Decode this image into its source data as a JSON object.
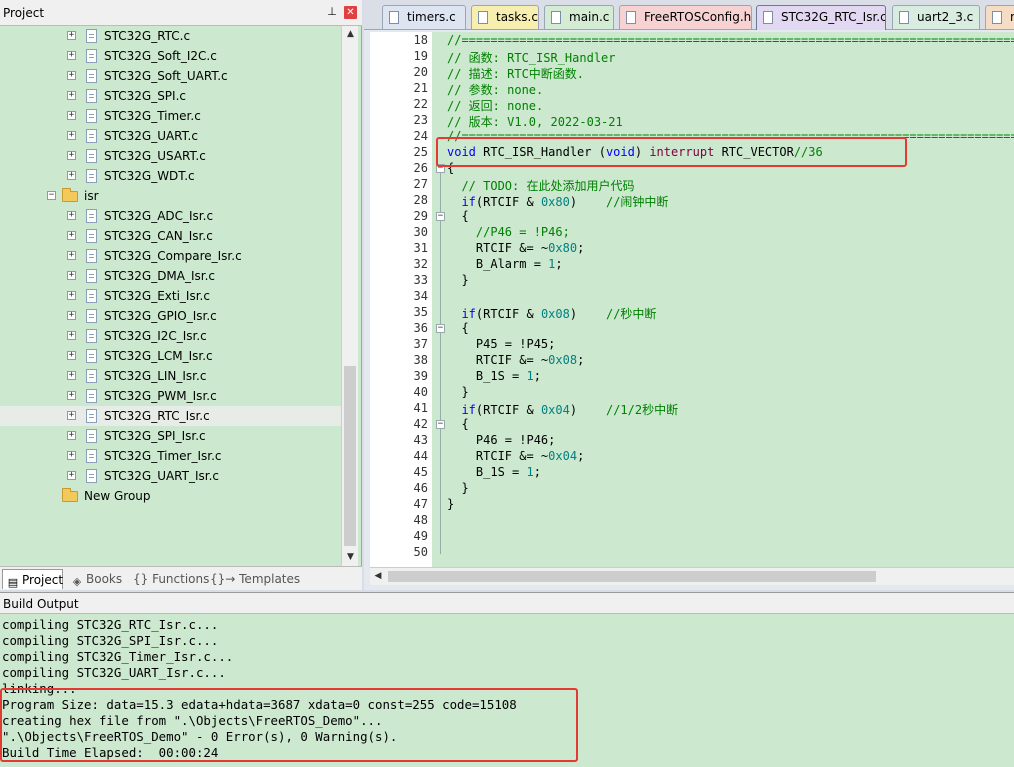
{
  "project_pane": {
    "title": "Project",
    "tree": [
      {
        "label": "STC32G_RTC.c",
        "type": "file",
        "level": 2
      },
      {
        "label": "STC32G_Soft_I2C.c",
        "type": "file",
        "level": 2
      },
      {
        "label": "STC32G_Soft_UART.c",
        "type": "file",
        "level": 2
      },
      {
        "label": "STC32G_SPI.c",
        "type": "file",
        "level": 2
      },
      {
        "label": "STC32G_Timer.c",
        "type": "file",
        "level": 2
      },
      {
        "label": "STC32G_UART.c",
        "type": "file",
        "level": 2
      },
      {
        "label": "STC32G_USART.c",
        "type": "file",
        "level": 2
      },
      {
        "label": "STC32G_WDT.c",
        "type": "file",
        "level": 2
      },
      {
        "label": "isr",
        "type": "folder",
        "level": 1,
        "expanded": true
      },
      {
        "label": "STC32G_ADC_Isr.c",
        "type": "file",
        "level": 2
      },
      {
        "label": "STC32G_CAN_Isr.c",
        "type": "file",
        "level": 2
      },
      {
        "label": "STC32G_Compare_Isr.c",
        "type": "file",
        "level": 2
      },
      {
        "label": "STC32G_DMA_Isr.c",
        "type": "file",
        "level": 2
      },
      {
        "label": "STC32G_Exti_Isr.c",
        "type": "file",
        "level": 2
      },
      {
        "label": "STC32G_GPIO_Isr.c",
        "type": "file",
        "level": 2
      },
      {
        "label": "STC32G_I2C_Isr.c",
        "type": "file",
        "level": 2
      },
      {
        "label": "STC32G_LCM_Isr.c",
        "type": "file",
        "level": 2
      },
      {
        "label": "STC32G_LIN_Isr.c",
        "type": "file",
        "level": 2
      },
      {
        "label": "STC32G_PWM_Isr.c",
        "type": "file",
        "level": 2
      },
      {
        "label": "STC32G_RTC_Isr.c",
        "type": "file",
        "level": 2,
        "selected": true
      },
      {
        "label": "STC32G_SPI_Isr.c",
        "type": "file",
        "level": 2
      },
      {
        "label": "STC32G_Timer_Isr.c",
        "type": "file",
        "level": 2
      },
      {
        "label": "STC32G_UART_Isr.c",
        "type": "file",
        "level": 2
      },
      {
        "label": "New Group",
        "type": "folder",
        "level": 0,
        "expanded": false
      }
    ],
    "bottom_tabs": [
      {
        "label": "Project",
        "icon": "project-icon",
        "active": true
      },
      {
        "label": "Books",
        "icon": "books-icon",
        "active": false
      },
      {
        "label": "{} Functions",
        "icon": "",
        "active": false
      },
      {
        "label": "{}→ Templates",
        "icon": "",
        "active": false
      }
    ]
  },
  "editor": {
    "tabs": [
      {
        "label": "timers.c",
        "color": "#dde5f3",
        "active": false
      },
      {
        "label": "tasks.c",
        "color": "#f7efb0",
        "active": false
      },
      {
        "label": "main.c",
        "color": "#d4ecd4",
        "active": false
      },
      {
        "label": "FreeRTOSConfig.h",
        "color": "#f7d2d2",
        "active": false
      },
      {
        "label": "STC32G_RTC_Isr.c*",
        "color": "#e2d8f2",
        "active": true
      },
      {
        "label": "uart2_3.c",
        "color": "#d8ece0",
        "active": false
      },
      {
        "label": "r",
        "color": "#f5dcc4",
        "active": false
      }
    ],
    "lines": [
      {
        "n": "18",
        "fold": "",
        "tokens": [
          {
            "t": "//==============================================================================",
            "c": "cmt"
          }
        ]
      },
      {
        "n": "19",
        "fold": "",
        "tokens": [
          {
            "t": "// 函数: RTC_ISR_Handler",
            "c": "cmt"
          }
        ]
      },
      {
        "n": "20",
        "fold": "",
        "tokens": [
          {
            "t": "// 描述: RTC中断函数.",
            "c": "cmt"
          }
        ]
      },
      {
        "n": "21",
        "fold": "",
        "tokens": [
          {
            "t": "// 参数: none.",
            "c": "cmt"
          }
        ]
      },
      {
        "n": "22",
        "fold": "",
        "tokens": [
          {
            "t": "// 返回: none.",
            "c": "cmt"
          }
        ]
      },
      {
        "n": "23",
        "fold": "",
        "tokens": [
          {
            "t": "// 版本: V1.0, 2022-03-21",
            "c": "cmt"
          }
        ]
      },
      {
        "n": "24",
        "fold": "",
        "tokens": [
          {
            "t": "//==============================================================================",
            "c": "cmt"
          }
        ]
      },
      {
        "n": "25",
        "fold": "",
        "tokens": [
          {
            "t": "void",
            "c": "kw"
          },
          {
            "t": " RTC_ISR_Handler (",
            "c": "txt"
          },
          {
            "t": "void",
            "c": "kw"
          },
          {
            "t": ") ",
            "c": "txt"
          },
          {
            "t": "interrupt",
            "c": "intr"
          },
          {
            "t": " RTC_VECTOR",
            "c": "txt"
          },
          {
            "t": "//36",
            "c": "cmt"
          }
        ]
      },
      {
        "n": "26",
        "fold": "minus",
        "tokens": [
          {
            "t": "{",
            "c": "txt"
          }
        ]
      },
      {
        "n": "27",
        "fold": "",
        "tokens": [
          {
            "t": "  ",
            "c": "txt"
          },
          {
            "t": "// TODO: 在此处添加用户代码",
            "c": "cmt"
          }
        ]
      },
      {
        "n": "28",
        "fold": "",
        "tokens": [
          {
            "t": "  ",
            "c": "txt"
          },
          {
            "t": "if",
            "c": "kw"
          },
          {
            "t": "(RTCIF & ",
            "c": "txt"
          },
          {
            "t": "0x80",
            "c": "num"
          },
          {
            "t": ")    ",
            "c": "txt"
          },
          {
            "t": "//闹钟中断",
            "c": "cmt"
          }
        ]
      },
      {
        "n": "29",
        "fold": "minus",
        "tokens": [
          {
            "t": "  {",
            "c": "txt"
          }
        ]
      },
      {
        "n": "30",
        "fold": "",
        "tokens": [
          {
            "t": "    ",
            "c": "txt"
          },
          {
            "t": "//P46 = !P46;",
            "c": "cmt"
          }
        ]
      },
      {
        "n": "31",
        "fold": "",
        "tokens": [
          {
            "t": "    RTCIF &= ~",
            "c": "txt"
          },
          {
            "t": "0x80",
            "c": "num"
          },
          {
            "t": ";",
            "c": "txt"
          }
        ]
      },
      {
        "n": "32",
        "fold": "",
        "tokens": [
          {
            "t": "    B_Alarm = ",
            "c": "txt"
          },
          {
            "t": "1",
            "c": "num"
          },
          {
            "t": ";",
            "c": "txt"
          }
        ]
      },
      {
        "n": "33",
        "fold": "",
        "tokens": [
          {
            "t": "  }",
            "c": "txt"
          }
        ]
      },
      {
        "n": "34",
        "fold": "",
        "tokens": [
          {
            "t": "",
            "c": "txt"
          }
        ]
      },
      {
        "n": "35",
        "fold": "",
        "tokens": [
          {
            "t": "  ",
            "c": "txt"
          },
          {
            "t": "if",
            "c": "kw"
          },
          {
            "t": "(RTCIF & ",
            "c": "txt"
          },
          {
            "t": "0x08",
            "c": "num"
          },
          {
            "t": ")    ",
            "c": "txt"
          },
          {
            "t": "//秒中断",
            "c": "cmt"
          }
        ]
      },
      {
        "n": "36",
        "fold": "minus",
        "tokens": [
          {
            "t": "  {",
            "c": "txt"
          }
        ]
      },
      {
        "n": "37",
        "fold": "",
        "tokens": [
          {
            "t": "    P45 = !P45;",
            "c": "txt"
          }
        ]
      },
      {
        "n": "38",
        "fold": "",
        "tokens": [
          {
            "t": "    RTCIF &= ~",
            "c": "txt"
          },
          {
            "t": "0x08",
            "c": "num"
          },
          {
            "t": ";",
            "c": "txt"
          }
        ]
      },
      {
        "n": "39",
        "fold": "",
        "tokens": [
          {
            "t": "    B_1S = ",
            "c": "txt"
          },
          {
            "t": "1",
            "c": "num"
          },
          {
            "t": ";",
            "c": "txt"
          }
        ]
      },
      {
        "n": "40",
        "fold": "",
        "tokens": [
          {
            "t": "  }",
            "c": "txt"
          }
        ]
      },
      {
        "n": "41",
        "fold": "",
        "tokens": [
          {
            "t": "  ",
            "c": "txt"
          },
          {
            "t": "if",
            "c": "kw"
          },
          {
            "t": "(RTCIF & ",
            "c": "txt"
          },
          {
            "t": "0x04",
            "c": "num"
          },
          {
            "t": ")    ",
            "c": "txt"
          },
          {
            "t": "//1/2秒中断",
            "c": "cmt"
          }
        ]
      },
      {
        "n": "42",
        "fold": "minus",
        "tokens": [
          {
            "t": "  {",
            "c": "txt"
          }
        ]
      },
      {
        "n": "43",
        "fold": "",
        "tokens": [
          {
            "t": "    P46 = !P46;",
            "c": "txt"
          }
        ]
      },
      {
        "n": "44",
        "fold": "",
        "tokens": [
          {
            "t": "    RTCIF &= ~",
            "c": "txt"
          },
          {
            "t": "0x04",
            "c": "num"
          },
          {
            "t": ";",
            "c": "txt"
          }
        ]
      },
      {
        "n": "45",
        "fold": "",
        "tokens": [
          {
            "t": "    B_1S = ",
            "c": "txt"
          },
          {
            "t": "1",
            "c": "num"
          },
          {
            "t": ";",
            "c": "txt"
          }
        ]
      },
      {
        "n": "46",
        "fold": "",
        "tokens": [
          {
            "t": "  }",
            "c": "txt"
          }
        ]
      },
      {
        "n": "47",
        "fold": "",
        "tokens": [
          {
            "t": "}",
            "c": "txt"
          }
        ]
      },
      {
        "n": "48",
        "fold": "",
        "tokens": [
          {
            "t": "",
            "c": "txt"
          }
        ]
      },
      {
        "n": "49",
        "fold": "",
        "tokens": [
          {
            "t": "",
            "c": "txt"
          }
        ]
      },
      {
        "n": "50",
        "fold": "",
        "tokens": [
          {
            "t": "",
            "c": "txt"
          }
        ]
      }
    ]
  },
  "build_output": {
    "title": "Build Output",
    "lines": [
      "compiling STC32G_RTC_Isr.c...",
      "compiling STC32G_SPI_Isr.c...",
      "compiling STC32G_Timer_Isr.c...",
      "compiling STC32G_UART_Isr.c...",
      "linking...",
      "Program Size: data=15.3 edata+hdata=3687 xdata=0 const=255 code=15108",
      "creating hex file from \".\\Objects\\FreeRTOS_Demo\"...",
      "\".\\Objects\\FreeRTOS_Demo\" - 0 Error(s), 0 Warning(s).",
      "Build Time Elapsed:  00:00:24"
    ]
  },
  "colors": {
    "highlight": "#e53935",
    "editor_bg": "#cce8cf",
    "comment": "#008000",
    "keyword": "#0000ff",
    "number": "#008080"
  }
}
